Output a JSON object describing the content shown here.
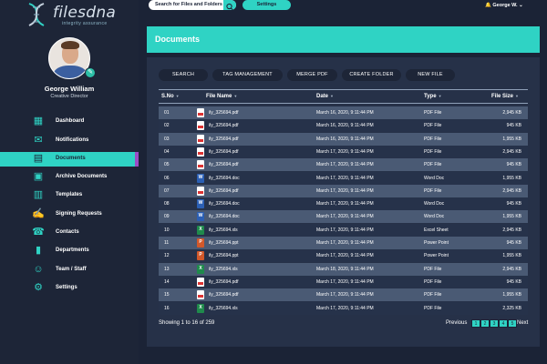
{
  "brand": {
    "name": "filesdna",
    "tagline": "integrity assurance"
  },
  "topbar": {
    "search_placeholder": "Search for Files and Folders",
    "settings_label": "Settings",
    "user_label": "George W."
  },
  "profile": {
    "name": "George William",
    "role": "Creative Director"
  },
  "nav": [
    {
      "label": "Dashboard",
      "icon": "dashboard-icon"
    },
    {
      "label": "Notifications",
      "icon": "notifications-icon"
    },
    {
      "label": "Documents",
      "icon": "documents-icon",
      "active": true
    },
    {
      "label": "Archive Documents",
      "icon": "archive-icon"
    },
    {
      "label": "Templates",
      "icon": "templates-icon"
    },
    {
      "label": "Signing Requests",
      "icon": "signing-icon"
    },
    {
      "label": "Contacts",
      "icon": "contacts-icon"
    },
    {
      "label": "Departments",
      "icon": "departments-icon"
    },
    {
      "label": "Team / Staff",
      "icon": "team-icon"
    },
    {
      "label": "Settings",
      "icon": "settings-icon"
    }
  ],
  "page_title": "Documents",
  "actions": [
    "SEARCH",
    "TAG MANAGEMENT",
    "MERGE PDF",
    "CREATE FOLDER",
    "NEW FILE"
  ],
  "table": {
    "headers": {
      "sno": "S.No",
      "file_name": "File Name",
      "date": "Date",
      "type": "Type",
      "size": "File Size"
    },
    "rows": [
      {
        "sno": "01",
        "file": "ily_325694.pdf",
        "kind": "pdf",
        "date": "March 16, 2020, 9:11:44 PM",
        "type": "PDF File",
        "size": "2,945 KB"
      },
      {
        "sno": "02",
        "file": "ily_325694.pdf",
        "kind": "pdf",
        "date": "March 16, 2020, 9:11:44 PM",
        "type": "PDF File",
        "size": "945 KB"
      },
      {
        "sno": "03",
        "file": "ily_325694.pdf",
        "kind": "pdf",
        "date": "March 16, 2020, 9:11:44 PM",
        "type": "PDF File",
        "size": "1,955 KB"
      },
      {
        "sno": "04",
        "file": "ily_325694.pdf",
        "kind": "pdf",
        "date": "March 17, 2020, 9:11:44 PM",
        "type": "PDF File",
        "size": "2,945 KB"
      },
      {
        "sno": "05",
        "file": "ily_325694.pdf",
        "kind": "pdf",
        "date": "March 17, 2020, 9:11:44 PM",
        "type": "PDF File",
        "size": "945 KB"
      },
      {
        "sno": "06",
        "file": "ily_325694.doc",
        "kind": "doc",
        "date": "March 17, 2020, 9:11:44 PM",
        "type": "Word Doc",
        "size": "1,955 KB"
      },
      {
        "sno": "07",
        "file": "ily_325694.pdf",
        "kind": "pdf",
        "date": "March 17, 2020, 9:11:44 PM",
        "type": "PDF File",
        "size": "2,945 KB"
      },
      {
        "sno": "08",
        "file": "ily_325694.doc",
        "kind": "doc",
        "date": "March 17, 2020, 9:11:44 PM",
        "type": "Word Doc",
        "size": "945 KB"
      },
      {
        "sno": "09",
        "file": "ily_325694.doc",
        "kind": "doc",
        "date": "March 17, 2020, 9:11:44 PM",
        "type": "Word Doc",
        "size": "1,955 KB"
      },
      {
        "sno": "10",
        "file": "ily_325694.xls",
        "kind": "xls",
        "date": "March 17, 2020, 9:11:44 PM",
        "type": "Excel Sheet",
        "size": "2,945 KB"
      },
      {
        "sno": "11",
        "file": "ily_325694.ppt",
        "kind": "ppt",
        "date": "March 17, 2020, 9:11:44 PM",
        "type": "Power Point",
        "size": "945 KB"
      },
      {
        "sno": "12",
        "file": "ily_325694.ppt",
        "kind": "ppt",
        "date": "March 17, 2020, 9:11:44 PM",
        "type": "Power Point",
        "size": "1,955 KB"
      },
      {
        "sno": "13",
        "file": "ily_325694.xls",
        "kind": "xls",
        "date": "March 18, 2020, 9:11:44 PM",
        "type": "PDF File",
        "size": "2,945 KB"
      },
      {
        "sno": "14",
        "file": "ily_325694.pdf",
        "kind": "pdf",
        "date": "March 17, 2020, 9:11:44 PM",
        "type": "PDF File",
        "size": "945 KB"
      },
      {
        "sno": "15",
        "file": "ily_325694.pdf",
        "kind": "pdf",
        "date": "March 17, 2020, 9:11:44 PM",
        "type": "PDF File",
        "size": "1,955 KB"
      },
      {
        "sno": "16",
        "file": "ily_325694.xls",
        "kind": "xls",
        "date": "March 17, 2020, 9:11:44 PM",
        "type": "PDF File",
        "size": "2,325 KB"
      }
    ]
  },
  "footer": {
    "showing": "Showing 1 to 16 of  259",
    "prev": "Previous",
    "next": "Next",
    "pages": [
      "1",
      "2",
      "3",
      "4",
      "5"
    ]
  },
  "colors": {
    "accent": "#2fd3c4",
    "sidebar": "#1d2537",
    "panel": "#263148",
    "active_marker": "#9b4dc4"
  }
}
